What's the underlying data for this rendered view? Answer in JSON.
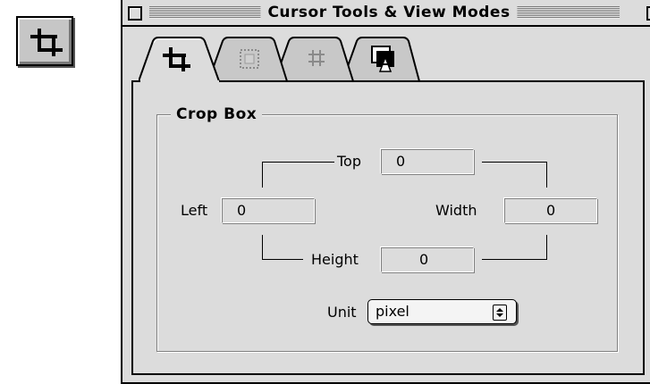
{
  "window": {
    "title": "Cursor Tools & View Modes"
  },
  "tabs": [
    {
      "name": "crop",
      "icon": "crop-icon",
      "selected": true
    },
    {
      "name": "selection",
      "icon": "marquee-icon",
      "selected": false
    },
    {
      "name": "grid",
      "icon": "grid-icon",
      "selected": false
    },
    {
      "name": "view",
      "icon": "view-mode-icon",
      "selected": false
    }
  ],
  "crop_box": {
    "title": "Crop Box",
    "top_label": "Top",
    "top_value": "0",
    "left_label": "Left",
    "left_value": "0",
    "width_label": "Width",
    "width_value": "0",
    "height_label": "Height",
    "height_value": "0",
    "unit_label": "Unit",
    "unit_value": "pixel"
  },
  "tool_button": {
    "icon": "crop-icon"
  },
  "colors": {
    "chrome": "#dcdcdc",
    "button": "#c6c6c6"
  }
}
